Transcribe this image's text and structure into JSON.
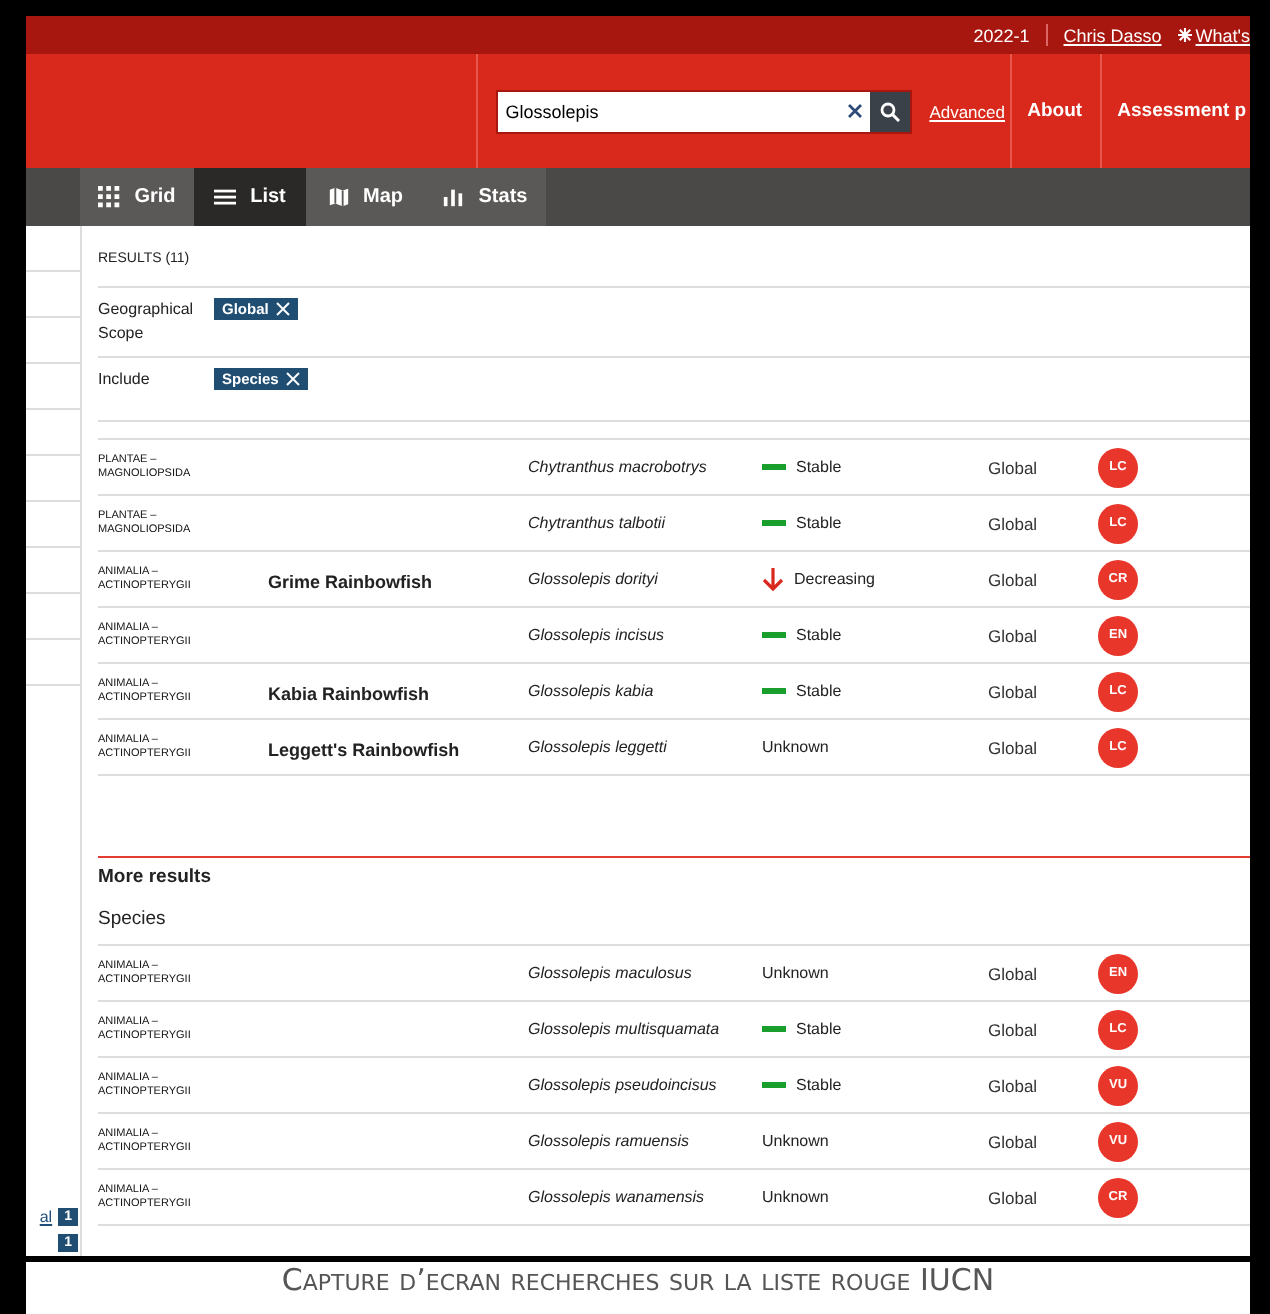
{
  "top_bar": {
    "version": "2022-1",
    "user": "Chris Dasso",
    "whats_new": "What's"
  },
  "header": {
    "search": {
      "value": "Glossolepis"
    },
    "links": [
      "Advanced"
    ],
    "nav": [
      "About",
      "Assessment p"
    ]
  },
  "view_tabs": [
    {
      "label": "Grid",
      "kind": "grid",
      "selected": false
    },
    {
      "label": "List",
      "kind": "list",
      "selected": true
    },
    {
      "label": "Map",
      "kind": "map",
      "selected": false
    },
    {
      "label": "Stats",
      "kind": "stats",
      "selected": false
    }
  ],
  "sidebar": {
    "link": "al",
    "badges": [
      "1",
      "1"
    ]
  },
  "results_heading": "RESULTS (11)",
  "filters": [
    {
      "label": "Geographical Scope",
      "tag": "Global"
    },
    {
      "label": "Include",
      "tag": "Species"
    }
  ],
  "results": [
    {
      "category": "PLANTAE – MAGNOLIOPSIDA",
      "scientific_name": "Chytranthus macrobotrys",
      "trend": {
        "kind": "stable",
        "label": "Stable"
      },
      "scope": "Global",
      "status": "LC"
    },
    {
      "category": "PLANTAE – MAGNOLIOPSIDA",
      "scientific_name": "Chytranthus talbotii",
      "trend": {
        "kind": "stable",
        "label": "Stable"
      },
      "scope": "Global",
      "status": "LC"
    },
    {
      "category": "ANIMALIA – ACTINOPTERYGII",
      "common_name": "Grime Rainbowfish",
      "scientific_name": "Glossolepis dorityi",
      "trend": {
        "kind": "decreasing",
        "label": "Decreasing"
      },
      "scope": "Global",
      "status": "CR"
    },
    {
      "category": "ANIMALIA – ACTINOPTERYGII",
      "scientific_name": "Glossolepis incisus",
      "trend": {
        "kind": "stable",
        "label": "Stable"
      },
      "scope": "Global",
      "status": "EN"
    },
    {
      "category": "ANIMALIA – ACTINOPTERYGII",
      "common_name": "Kabia Rainbowfish",
      "scientific_name": "Glossolepis kabia",
      "trend": {
        "kind": "stable",
        "label": "Stable"
      },
      "scope": "Global",
      "status": "LC"
    },
    {
      "category": "ANIMALIA – ACTINOPTERYGII",
      "common_name": "Leggett's Rainbowfish",
      "scientific_name": "Glossolepis leggetti",
      "trend": {
        "kind": "unknown",
        "label": "Unknown"
      },
      "scope": "Global",
      "status": "LC"
    }
  ],
  "more_results": {
    "title": "More results",
    "subtitle": "Species",
    "rows": [
      {
        "category": "ANIMALIA – ACTINOPTERYGII",
        "scientific_name": "Glossolepis maculosus",
        "trend": {
          "kind": "unknown",
          "label": "Unknown"
        },
        "scope": "Global",
        "status": "EN"
      },
      {
        "category": "ANIMALIA – ACTINOPTERYGII",
        "scientific_name": "Glossolepis multisquamata",
        "trend": {
          "kind": "stable",
          "label": "Stable"
        },
        "scope": "Global",
        "status": "LC"
      },
      {
        "category": "ANIMALIA – ACTINOPTERYGII",
        "scientific_name": "Glossolepis pseudoincisus",
        "trend": {
          "kind": "stable",
          "label": "Stable"
        },
        "scope": "Global",
        "status": "VU"
      },
      {
        "category": "ANIMALIA – ACTINOPTERYGII",
        "scientific_name": "Glossolepis ramuensis",
        "trend": {
          "kind": "unknown",
          "label": "Unknown"
        },
        "scope": "Global",
        "status": "VU"
      },
      {
        "category": "ANIMALIA – ACTINOPTERYGII",
        "scientific_name": "Glossolepis wanamensis",
        "trend": {
          "kind": "unknown",
          "label": "Unknown"
        },
        "scope": "Global",
        "status": "CR"
      }
    ]
  },
  "caption": "Capture d’ecran recherches sur la liste rouge IUCN"
}
